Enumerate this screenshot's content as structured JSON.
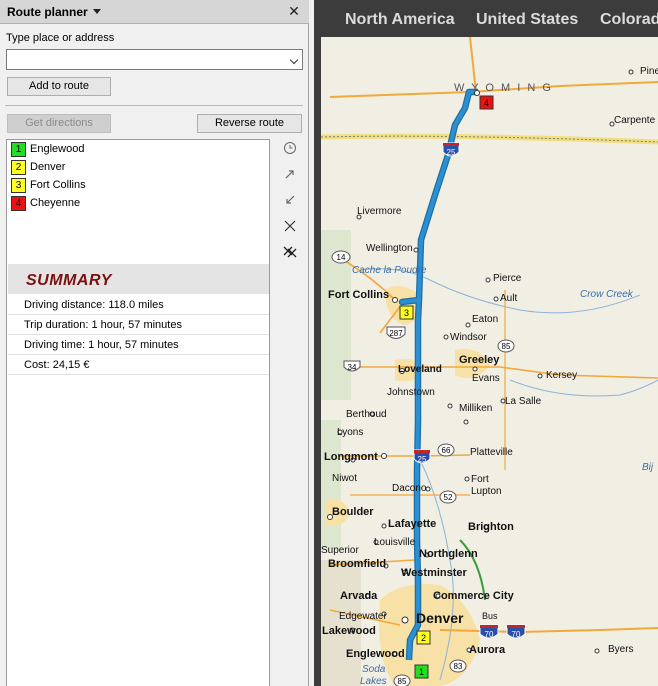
{
  "panel": {
    "title": "Route planner",
    "close_glyph": "✕",
    "place_label": "Type place or address",
    "place_value": "",
    "add_button": "Add to route",
    "get_directions_button": "Get directions",
    "reverse_button": "Reverse route"
  },
  "waypoints": [
    {
      "num": "1",
      "name": "Englewood",
      "color": "#22dd22"
    },
    {
      "num": "2",
      "name": "Denver",
      "color": "#ffff22"
    },
    {
      "num": "3",
      "name": "Fort Collins",
      "color": "#ffff22"
    },
    {
      "num": "4",
      "name": "Cheyenne",
      "color": "#ee1111"
    }
  ],
  "summary": {
    "title": "SUMMARY",
    "distance": "Driving distance:  118.0 miles",
    "duration": "Trip duration:  1 hour, 57 minutes",
    "driving_time": "Driving time:  1 hour, 57 minutes",
    "cost": "Cost:  24,15 €"
  },
  "tools": [
    "clock-icon",
    "arrow-up-right-icon",
    "arrow-down-left-icon",
    "delete-waypoint-icon",
    "clear-route-icon"
  ],
  "breadcrumb": [
    "North America",
    "United States",
    "Colorado"
  ],
  "map": {
    "state_label": "W Y O M I N G",
    "places": {
      "pine": "Pine",
      "carpenter": "Carpente",
      "livermore": "Livermore",
      "wellington": "Wellington",
      "cache": "Cache la Poudre",
      "pierce": "Pierce",
      "ault": "Ault",
      "crowcreek": "Crow Creek",
      "fortcollins": "Fort Collins",
      "eaton": "Eaton",
      "windsor": "Windsor",
      "greeley": "Greeley",
      "loveland": "Loveland",
      "evans": "Evans",
      "kersey": "Kersey",
      "johnstown": "Johnstown",
      "lasalle": "La Salle",
      "berthoud": "Berthoud",
      "milliken": "Milliken",
      "lyons": "Lyons",
      "platteville": "Platteville",
      "longmont": "Longmont",
      "niwot": "Niwot",
      "fortlupton": "Fort\nLupton",
      "dacono": "Dacono",
      "boulder": "Boulder",
      "lafayette": "Lafayette",
      "brighton": "Brighton",
      "louisville": "Louisville",
      "superior": "Superior",
      "northglenn": "Northglenn",
      "broomfield": "Broomfield",
      "westminster": "Westminster",
      "arvada": "Arvada",
      "commercecity": "Commerce City",
      "edgewater": "Edgewater",
      "bus": "Bus",
      "denver": "Denver",
      "lakewood": "Lakewood",
      "aurora": "Aurora",
      "byers": "Byers",
      "englewood": "Englewood",
      "bij": "Bij",
      "soda": "Soda",
      "lakes": "Lakes"
    },
    "shields": {
      "i25_north": "25",
      "i25_south": "25",
      "r14": "14",
      "r287": "287",
      "r85_1": "85",
      "r34": "34",
      "r66": "66",
      "r52": "52",
      "r70_1": "70",
      "r70_2": "70",
      "r83": "83",
      "r85_2": "85"
    },
    "route_color": "#2c8fd0",
    "road_color": "#f2a93b"
  }
}
